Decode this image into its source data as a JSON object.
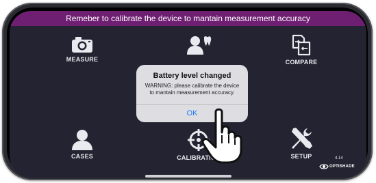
{
  "banner": {
    "text": "Remeber to calibrate the device to mantain measurement accuracy"
  },
  "menu": {
    "measure": "MEASURE",
    "compare": "COMPARE",
    "cases": "CASES",
    "calibration": "CALIBRATION",
    "setup": "SETUP"
  },
  "dialog": {
    "title": "Battery level changed",
    "message": "WARNING: please calibrate the device to mantain measurement accuracy.",
    "ok_label": "OK"
  },
  "footer": {
    "version": "4.14",
    "brand": "OPTISHADE"
  },
  "colors": {
    "banner": "#6e1f72",
    "background": "#232331",
    "dialog_button": "#1e7cf2"
  },
  "icons": [
    "camera-icon",
    "person-tooth-icon",
    "compare-files-icon",
    "person-icon",
    "crosshair-icon",
    "wrench-screwdriver-icon",
    "eye-logo-icon",
    "pointing-hand-icon"
  ]
}
